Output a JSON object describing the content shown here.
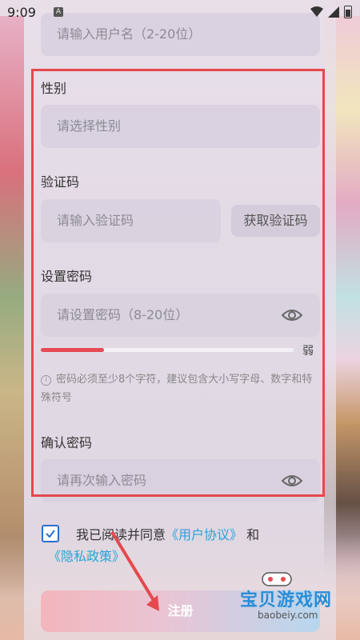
{
  "status_bar": {
    "time": "9:09",
    "notif_icon": "A"
  },
  "form": {
    "username_placeholder": "请输入用户名（2-20位）",
    "gender_label": "性别",
    "gender_placeholder": "请选择性别",
    "code_label": "验证码",
    "code_placeholder": "请输入验证码",
    "get_code_button": "获取验证码",
    "password_label": "设置密码",
    "password_placeholder": "请设置密码（8-20位）",
    "strength_label": "弱",
    "strength_level": 0.25,
    "password_hint": "密码必须至少8个字符，建议包含大小写字母、数字和特殊符号",
    "confirm_label": "确认密码",
    "confirm_placeholder": "请再次输入密码"
  },
  "agreement": {
    "prefix": "我已阅读并同意",
    "user_agreement": "《用户协议》",
    "and": "和",
    "privacy_policy": "《隐私政策》",
    "checked": true
  },
  "register_button": "注册",
  "watermark": {
    "name": "宝贝游戏网",
    "url": "baobeiy.com"
  },
  "colors": {
    "accent_red": "#e5484d",
    "link_blue": "#29a3d9",
    "checkbox_blue": "#2a6fd1"
  }
}
